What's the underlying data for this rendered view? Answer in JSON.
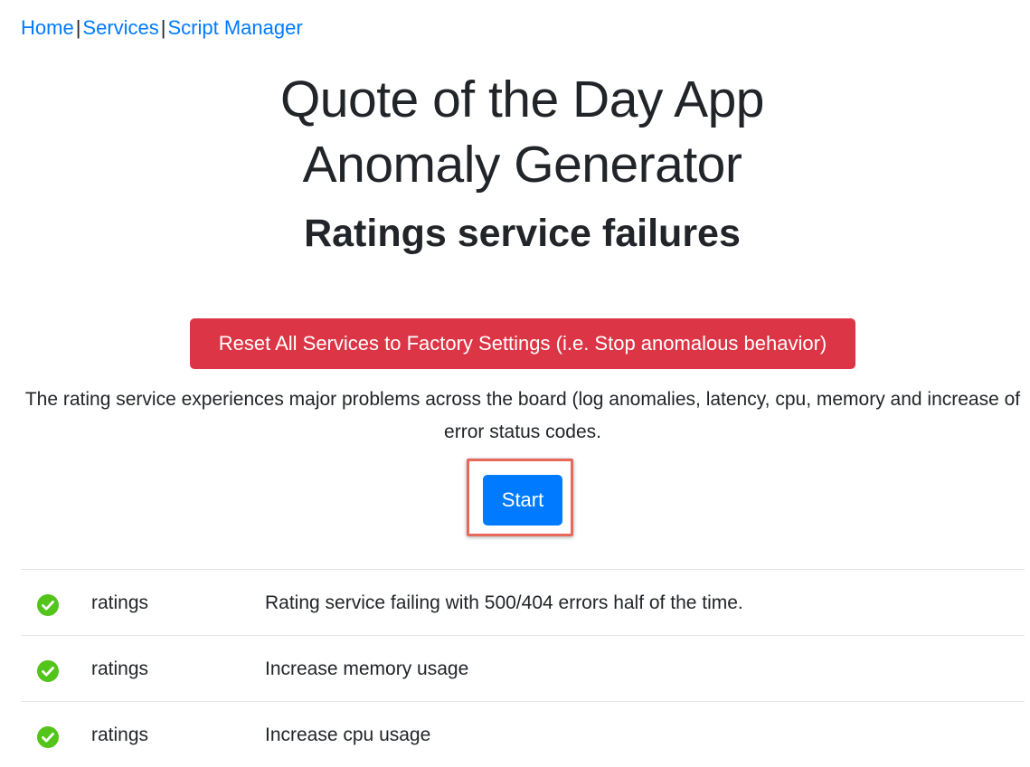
{
  "nav": {
    "home": "Home",
    "services": "Services",
    "script_manager": "Script Manager",
    "separator": "|"
  },
  "header": {
    "title_line1": "Quote of the Day App",
    "title_line2": "Anomaly Generator",
    "subtitle": "Ratings service failures"
  },
  "reset_button": {
    "label": "Reset All Services to Factory Settings (i.e. Stop anomalous behavior)",
    "color": "#dc3545"
  },
  "description": "The rating service experiences major problems across the board (log anomalies, latency, cpu, memory and increase of error status codes.",
  "start_button": {
    "label": "Start",
    "color": "#007bff"
  },
  "anomalies": [
    {
      "status_icon": "check-circle-icon",
      "service": "ratings",
      "description": "Rating service failing with 500/404 errors half of the time."
    },
    {
      "status_icon": "check-circle-icon",
      "service": "ratings",
      "description": "Increase memory usage"
    },
    {
      "status_icon": "check-circle-icon",
      "service": "ratings",
      "description": "Increase cpu usage"
    }
  ],
  "colors": {
    "link": "#007bff",
    "check": "#52c41a",
    "highlight": "#e8685a"
  }
}
